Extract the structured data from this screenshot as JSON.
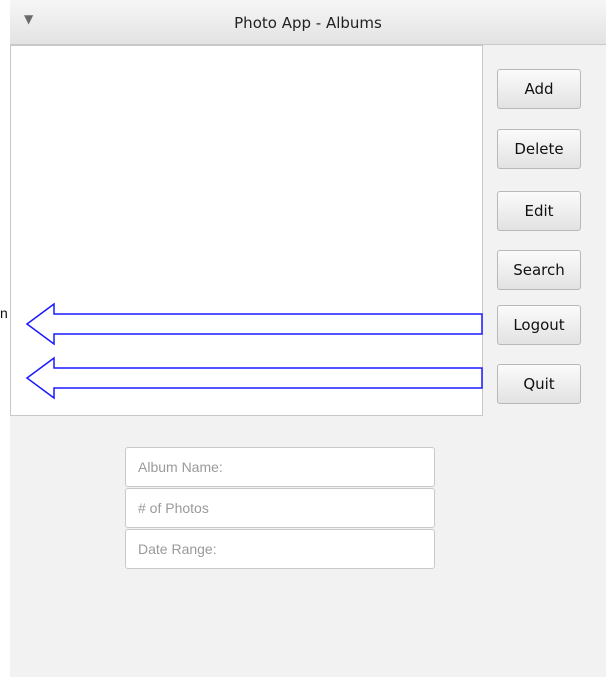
{
  "window": {
    "title": "Photo App - Albums",
    "menu_icon": "triangle-down-icon"
  },
  "side_label": "n",
  "buttons": {
    "add": "Add",
    "delete": "Delete",
    "edit": "Edit",
    "search": "Search",
    "logout": "Logout",
    "quit": "Quit"
  },
  "fields": {
    "album_name_placeholder": "Album Name:",
    "photo_count_placeholder": "# of Photos",
    "date_range_placeholder": "Date Range:"
  },
  "colors": {
    "arrow_stroke": "#1a1aff"
  }
}
